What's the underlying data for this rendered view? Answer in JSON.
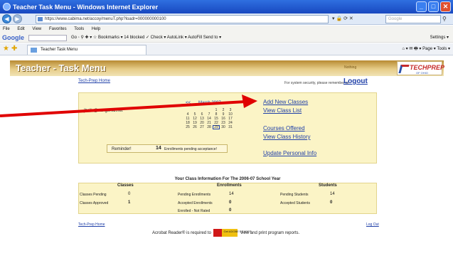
{
  "window": {
    "title": "Teacher Task Menu - Windows Internet Explorer",
    "minimize": "_",
    "maximize": "□",
    "close": "✕"
  },
  "browser": {
    "url": "https://www.cabima.net/accoy/menuT.php?loadr=000000000100",
    "search_placeholder": "Google",
    "menu": [
      "File",
      "Edit",
      "View",
      "Favorites",
      "Tools",
      "Help"
    ],
    "google_logo": "Google",
    "google_tools": "Go ◦ ⚲ ✚ ▾  ☆ Bookmarks ▾  14 blocked  ✓ Check ▾  AutoLink ▾  AutoFill  Send to ▾",
    "settings": "Settings ▾",
    "tab_title": "Teacher Task Menu",
    "tab_tools": "⌂ ▾  ✉  🖶 ▾  Page ▾  Tools ▾"
  },
  "header": {
    "title": "Teacher - Task Menu",
    "meta": "Nothing",
    "logo_text": "TECHPREP",
    "logo_sub": "OF OHIO"
  },
  "top": {
    "home_link": "Tech-Prep Home",
    "security_note": "For system security, please remember to",
    "logout": "Logout"
  },
  "user": {
    "email": "jhalls@sangersd.net"
  },
  "calendar": {
    "prev": "<<",
    "next": ">>",
    "title": "March 2007",
    "days": [
      "",
      "",
      "",
      "",
      "1",
      "2",
      "3",
      "4",
      "5",
      "6",
      "7",
      "8",
      "9",
      "10",
      "11",
      "12",
      "13",
      "14",
      "15",
      "16",
      "17",
      "18",
      "19",
      "20",
      "21",
      "22",
      "23",
      "24",
      "25",
      "26",
      "27",
      "28",
      "29",
      "30",
      "31"
    ],
    "today": "29"
  },
  "menu": {
    "add_classes": "Add New Classes",
    "view_list": "View Class List",
    "courses": "Courses Offered",
    "history": "View Class History",
    "update": "Update Personal Info"
  },
  "reminder": {
    "label": "Reminder!",
    "count": "14",
    "text": "Enrollments pending acceptance!"
  },
  "info": {
    "title": "Your Class Information For The 2006-07 School Year",
    "classes": {
      "head": "Classes",
      "pending_label": "Classes Pending",
      "pending": "0",
      "approved_label": "Classes Approved",
      "approved": "1"
    },
    "enrollments": {
      "head": "Enrollments",
      "pending_label": "Pending Enrollments",
      "pending": "14",
      "accepted_label": "Accepted Enrollments",
      "accepted": "0",
      "notrated_label": "Enrolled - Not Rated",
      "notrated": "0"
    },
    "students": {
      "head": "Students",
      "pending_label": "Pending Students",
      "pending": "14",
      "accepted_label": "Accepted Students",
      "accepted": "0"
    }
  },
  "footer": {
    "home_link": "Tech-Prep Home",
    "logout": "Log Out",
    "acrobat_before": "Acrobat Reader® is required to",
    "acrobat_badge": "Get ADOBE READER",
    "acrobat_after": "view and print program reports."
  },
  "colors": {
    "header_gold": "#b88a32",
    "panel": "#fbf4c6",
    "link": "#2040a8",
    "arrow": "#e00000"
  }
}
